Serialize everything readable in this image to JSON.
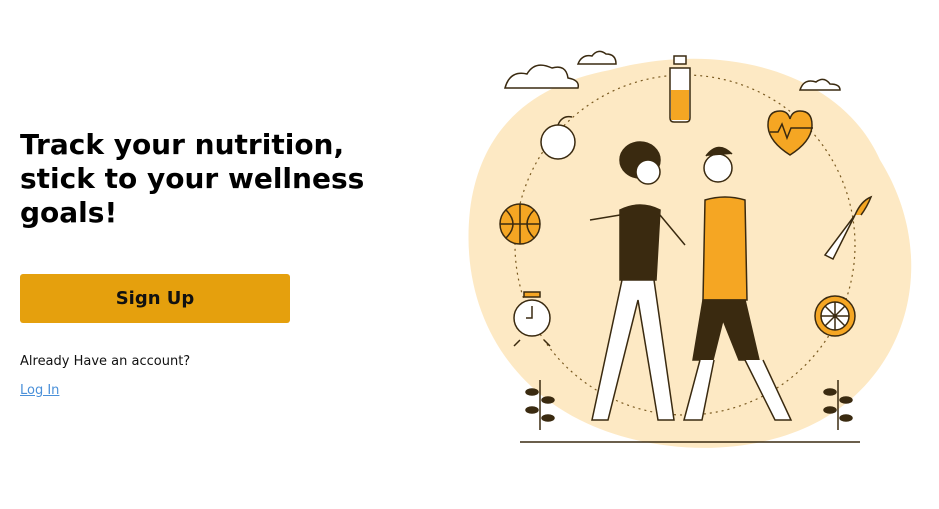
{
  "hero": {
    "headline": "Track your nutrition, stick to your wellness goals!",
    "signup_label": "Sign Up",
    "account_prompt": "Already Have an account?",
    "login_label": "Log In"
  },
  "illustration": {
    "name": "couple-walking-wellness-illustration",
    "icons": [
      "cloud-icon",
      "water-bottle-icon",
      "heart-rate-icon",
      "apple-icon",
      "basketball-icon",
      "carrot-icon",
      "alarm-clock-icon",
      "orange-slice-icon",
      "plant-icon"
    ]
  },
  "colors": {
    "accent": "#e5a00d",
    "link": "#4a90d9",
    "blob": "#fde9c4",
    "ink": "#3a2a10"
  }
}
